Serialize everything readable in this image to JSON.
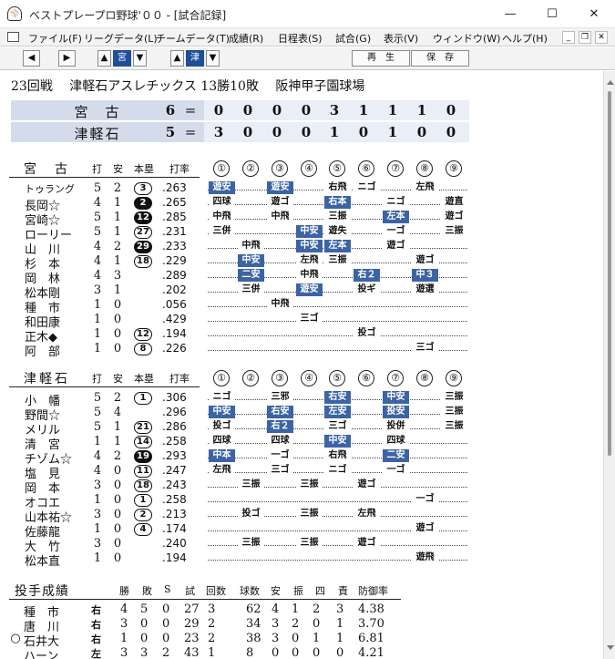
{
  "window": {
    "title": "ベストプレープロ野球'００ - [試合記録]",
    "minimize": "—",
    "maximize": "☐",
    "close": "✕"
  },
  "menu": [
    "ファイル(F)",
    "リーグデータ(L)",
    "チームデータ(T)",
    "成績(R)",
    "日程表(S)",
    "試合(G)",
    "表示(V)",
    "ウィンドウ(W)",
    "ヘルプ(H)"
  ],
  "toolbar": {
    "team1": "宮",
    "team2": "津",
    "replay": "再　生",
    "save": "保　存"
  },
  "game": {
    "number": "23回戦",
    "team": "津軽石アスレチックス",
    "record": "13勝10敗",
    "stadium": "阪神甲子園球場"
  },
  "scoreboard": [
    {
      "team": "宮　古",
      "total": "6",
      "eq": "=",
      "innings": [
        "0",
        "0",
        "0",
        "0",
        "3",
        "1",
        "1",
        "1",
        "0"
      ]
    },
    {
      "team": "津軽石",
      "total": "5",
      "eq": "=",
      "innings": [
        "3",
        "0",
        "0",
        "0",
        "1",
        "0",
        "1",
        "0",
        "0"
      ]
    }
  ],
  "columns": {
    "ab": "打",
    "h": "安",
    "hr": "本塁",
    "avg": "打率"
  },
  "inning_marks": [
    "①",
    "②",
    "③",
    "④",
    "⑤",
    "⑥",
    "⑦",
    "⑧",
    "⑨"
  ],
  "batting": [
    {
      "team": "宮　古",
      "players": [
        {
          "name": "トゥラング",
          "ab": "5",
          "h": "2",
          "hr": "3",
          "hr_dark": false,
          "avg": ".263",
          "events": [
            {
              "inn": 1,
              "text": "遊安",
              "hit": true
            },
            {
              "inn": 3,
              "text": "遊安",
              "hit": true
            },
            {
              "inn": 5,
              "text": "右飛",
              "hit": false
            },
            {
              "inn": 6,
              "text": "ニゴ",
              "hit": false
            },
            {
              "inn": 8,
              "text": "左飛",
              "hit": false
            }
          ]
        },
        {
          "name": "長岡☆",
          "ab": "4",
          "h": "1",
          "hr": "2",
          "hr_dark": true,
          "avg": ".265",
          "events": [
            {
              "inn": 1,
              "text": "四球",
              "hit": false
            },
            {
              "inn": 3,
              "text": "遊ゴ",
              "hit": false
            },
            {
              "inn": 5,
              "text": "右本",
              "hit": true
            },
            {
              "inn": 7,
              "text": "ニゴ",
              "hit": false
            },
            {
              "inn": 9,
              "text": "遊直",
              "hit": false
            }
          ]
        },
        {
          "name": "宮崎☆",
          "ab": "5",
          "h": "1",
          "hr": "12",
          "hr_dark": true,
          "avg": ".285",
          "events": [
            {
              "inn": 1,
              "text": "中飛",
              "hit": false
            },
            {
              "inn": 3,
              "text": "中飛",
              "hit": false
            },
            {
              "inn": 5,
              "text": "三振",
              "hit": false
            },
            {
              "inn": 7,
              "text": "左本",
              "hit": true
            },
            {
              "inn": 9,
              "text": "遊ゴ",
              "hit": false
            }
          ]
        },
        {
          "name": "ローリー",
          "ab": "5",
          "h": "1",
          "hr": "27",
          "hr_dark": false,
          "avg": ".231",
          "events": [
            {
              "inn": 1,
              "text": "三併",
              "hit": false
            },
            {
              "inn": 4,
              "text": "中安",
              "hit": true
            },
            {
              "inn": 5,
              "text": "遊失",
              "hit": false
            },
            {
              "inn": 7,
              "text": "一ゴ",
              "hit": false
            },
            {
              "inn": 9,
              "text": "三振",
              "hit": false
            }
          ]
        },
        {
          "name": "山　川",
          "ab": "4",
          "h": "2",
          "hr": "29",
          "hr_dark": true,
          "avg": ".233",
          "events": [
            {
              "inn": 2,
              "text": "中飛",
              "hit": false
            },
            {
              "inn": 4,
              "text": "中安",
              "hit": true
            },
            {
              "inn": 5,
              "text": "左本",
              "hit": true
            },
            {
              "inn": 7,
              "text": "遊ゴ",
              "hit": false
            }
          ]
        },
        {
          "name": "杉　本",
          "ab": "4",
          "h": "1",
          "hr": "18",
          "hr_dark": false,
          "avg": ".229",
          "events": [
            {
              "inn": 2,
              "text": "中安",
              "hit": true
            },
            {
              "inn": 4,
              "text": "左飛",
              "hit": false
            },
            {
              "inn": 5,
              "text": "三振",
              "hit": false
            },
            {
              "inn": 8,
              "text": "遊ゴ",
              "hit": false
            }
          ]
        },
        {
          "name": "岡　林",
          "ab": "4",
          "h": "3",
          "hr": "",
          "hr_dark": false,
          "avg": ".289",
          "events": [
            {
              "inn": 2,
              "text": "二安",
              "hit": true
            },
            {
              "inn": 4,
              "text": "中飛",
              "hit": false
            },
            {
              "inn": 6,
              "text": "右２",
              "hit": true
            },
            {
              "inn": 8,
              "text": "中３",
              "hit": true
            }
          ]
        },
        {
          "name": "松本剛",
          "ab": "3",
          "h": "1",
          "hr": "",
          "hr_dark": false,
          "avg": ".202",
          "events": [
            {
              "inn": 2,
              "text": "三併",
              "hit": false
            },
            {
              "inn": 4,
              "text": "遊安",
              "hit": true
            },
            {
              "inn": 6,
              "text": "投ギ",
              "hit": false
            },
            {
              "inn": 8,
              "text": "遊選",
              "hit": false
            }
          ]
        },
        {
          "name": "種　市",
          "ab": "1",
          "h": "0",
          "hr": "",
          "hr_dark": false,
          "avg": ".056",
          "events": [
            {
              "inn": 3,
              "text": "中飛",
              "hit": false
            }
          ]
        },
        {
          "name": "和田康",
          "ab": "1",
          "h": "0",
          "hr": "",
          "hr_dark": false,
          "avg": ".429",
          "events": [
            {
              "inn": 4,
              "text": "三ゴ",
              "hit": false
            }
          ]
        },
        {
          "name": "正木◆",
          "ab": "1",
          "h": "0",
          "hr": "12",
          "hr_dark": false,
          "avg": ".194",
          "events": [
            {
              "inn": 6,
              "text": "投ゴ",
              "hit": false
            }
          ]
        },
        {
          "name": "阿　部",
          "ab": "1",
          "h": "0",
          "hr": "8",
          "hr_dark": false,
          "avg": ".226",
          "events": [
            {
              "inn": 8,
              "text": "三ゴ",
              "hit": false
            }
          ]
        }
      ]
    },
    {
      "team": "津軽石",
      "players": [
        {
          "name": "小　幡",
          "ab": "5",
          "h": "2",
          "hr": "1",
          "hr_dark": false,
          "avg": ".306",
          "events": [
            {
              "inn": 1,
              "text": "ニゴ",
              "hit": false
            },
            {
              "inn": 3,
              "text": "三邪",
              "hit": false
            },
            {
              "inn": 5,
              "text": "右安",
              "hit": true
            },
            {
              "inn": 7,
              "text": "中安",
              "hit": true
            },
            {
              "inn": 9,
              "text": "三振",
              "hit": false
            }
          ]
        },
        {
          "name": "野間☆",
          "ab": "5",
          "h": "4",
          "hr": "",
          "hr_dark": false,
          "avg": ".296",
          "events": [
            {
              "inn": 1,
              "text": "中安",
              "hit": true
            },
            {
              "inn": 3,
              "text": "右安",
              "hit": true
            },
            {
              "inn": 5,
              "text": "左安",
              "hit": true
            },
            {
              "inn": 7,
              "text": "投安",
              "hit": true
            },
            {
              "inn": 9,
              "text": "三振",
              "hit": false
            }
          ]
        },
        {
          "name": "メリル",
          "ab": "5",
          "h": "1",
          "hr": "21",
          "hr_dark": false,
          "avg": ".286",
          "events": [
            {
              "inn": 1,
              "text": "投ゴ",
              "hit": false
            },
            {
              "inn": 3,
              "text": "右２",
              "hit": true
            },
            {
              "inn": 5,
              "text": "三ゴ",
              "hit": false
            },
            {
              "inn": 7,
              "text": "投併",
              "hit": false
            },
            {
              "inn": 9,
              "text": "三振",
              "hit": false
            }
          ]
        },
        {
          "name": "清　宮",
          "ab": "1",
          "h": "1",
          "hr": "14",
          "hr_dark": false,
          "avg": ".258",
          "events": [
            {
              "inn": 1,
              "text": "四球",
              "hit": false
            },
            {
              "inn": 3,
              "text": "四球",
              "hit": false
            },
            {
              "inn": 5,
              "text": "中安",
              "hit": true
            },
            {
              "inn": 7,
              "text": "四球",
              "hit": false
            }
          ]
        },
        {
          "name": "チゾム☆",
          "ab": "4",
          "h": "2",
          "hr": "19",
          "hr_dark": true,
          "avg": ".293",
          "events": [
            {
              "inn": 1,
              "text": "中本",
              "hit": true
            },
            {
              "inn": 3,
              "text": "一ゴ",
              "hit": false
            },
            {
              "inn": 5,
              "text": "右飛",
              "hit": false
            },
            {
              "inn": 7,
              "text": "二安",
              "hit": true
            }
          ]
        },
        {
          "name": "塩　見",
          "ab": "4",
          "h": "0",
          "hr": "11",
          "hr_dark": false,
          "avg": ".247",
          "events": [
            {
              "inn": 1,
              "text": "左飛",
              "hit": false
            },
            {
              "inn": 3,
              "text": "三ゴ",
              "hit": false
            },
            {
              "inn": 5,
              "text": "ニゴ",
              "hit": false
            },
            {
              "inn": 7,
              "text": "一ゴ",
              "hit": false
            }
          ]
        },
        {
          "name": "岡　本",
          "ab": "3",
          "h": "0",
          "hr": "18",
          "hr_dark": false,
          "avg": ".243",
          "events": [
            {
              "inn": 2,
              "text": "三振",
              "hit": false
            },
            {
              "inn": 4,
              "text": "三振",
              "hit": false
            },
            {
              "inn": 6,
              "text": "遊ゴ",
              "hit": false
            }
          ]
        },
        {
          "name": "オコエ",
          "ab": "1",
          "h": "0",
          "hr": "1",
          "hr_dark": false,
          "avg": ".258",
          "events": [
            {
              "inn": 8,
              "text": "一ゴ",
              "hit": false
            }
          ]
        },
        {
          "name": "山本祐☆",
          "ab": "3",
          "h": "0",
          "hr": "2",
          "hr_dark": false,
          "avg": ".213",
          "events": [
            {
              "inn": 2,
              "text": "投ゴ",
              "hit": false
            },
            {
              "inn": 4,
              "text": "三振",
              "hit": false
            },
            {
              "inn": 6,
              "text": "左飛",
              "hit": false
            }
          ]
        },
        {
          "name": "佐藤龍",
          "ab": "1",
          "h": "0",
          "hr": "4",
          "hr_dark": false,
          "avg": ".174",
          "events": [
            {
              "inn": 8,
              "text": "遊ゴ",
              "hit": false
            }
          ]
        },
        {
          "name": "大　竹",
          "ab": "3",
          "h": "0",
          "hr": "",
          "hr_dark": false,
          "avg": ".240",
          "events": [
            {
              "inn": 2,
              "text": "三振",
              "hit": false
            },
            {
              "inn": 4,
              "text": "三振",
              "hit": false
            },
            {
              "inn": 6,
              "text": "遊ゴ",
              "hit": false
            }
          ]
        },
        {
          "name": "松本直",
          "ab": "1",
          "h": "0",
          "hr": "",
          "hr_dark": false,
          "avg": ".194",
          "events": [
            {
              "inn": 8,
              "text": "遊飛",
              "hit": false
            }
          ]
        }
      ]
    }
  ],
  "pitching": {
    "title": "投手成績",
    "headers": [
      "勝",
      "敗",
      "S",
      "試",
      "回数",
      "球数",
      "安",
      "振",
      "四",
      "責",
      "防御率"
    ],
    "rows": [
      {
        "mark": "",
        "name": "種　市",
        "hand": "右",
        "vals": [
          "4",
          "5",
          "0",
          "27",
          "3",
          "62",
          "4",
          "1",
          "2",
          "3",
          "4.38"
        ]
      },
      {
        "mark": "",
        "name": "唐　川",
        "hand": "右",
        "vals": [
          "3",
          "0",
          "0",
          "29",
          "2",
          "34",
          "3",
          "2",
          "0",
          "1",
          "3.70"
        ]
      },
      {
        "mark": "○",
        "name": "石井大",
        "hand": "右",
        "vals": [
          "1",
          "0",
          "0",
          "23",
          "2",
          "38",
          "3",
          "0",
          "1",
          "1",
          "6.81"
        ]
      },
      {
        "mark": "",
        "name": "ハーン",
        "hand": "左",
        "vals": [
          "3",
          "3",
          "2",
          "43",
          "1",
          "8",
          "0",
          "0",
          "0",
          "0",
          "4.21"
        ]
      }
    ]
  }
}
